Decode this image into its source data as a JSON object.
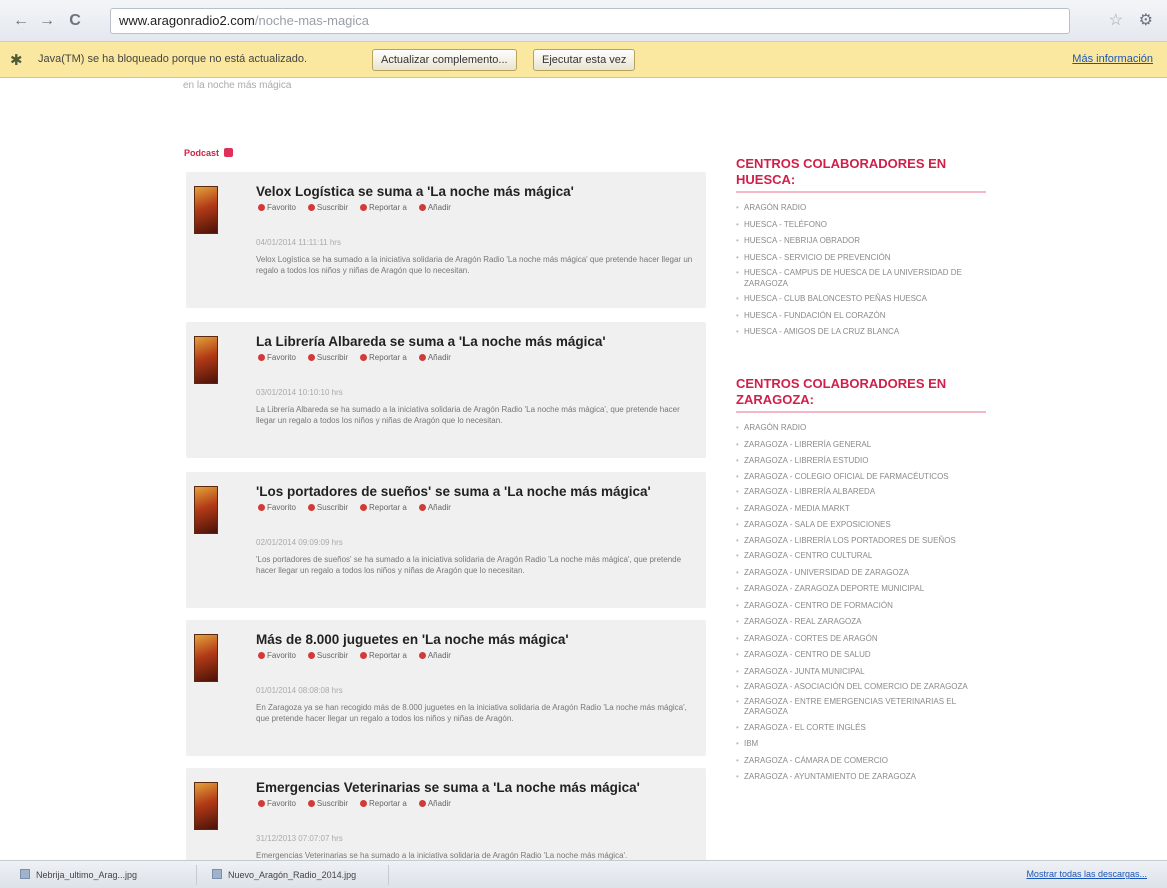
{
  "browser": {
    "url_host": "www.aragonradio2.com",
    "url_path": "/noche-mas-magica",
    "back_icon": "←",
    "forward_icon": "→",
    "reload_icon": "C",
    "star_icon": "☆",
    "wrench_icon": "⚙"
  },
  "infobar": {
    "message": "Java(TM) se ha bloqueado porque no está actualizado.",
    "update_button": "Actualizar complemento...",
    "run_button": "Ejecutar esta vez",
    "more_link": "Más información"
  },
  "faded_top": "en la noche más mágica",
  "feed": {
    "title": "Podcast",
    "actions": {
      "favorite": "Favorito",
      "subscribe": "Suscribir",
      "report": "Reportar a",
      "share": "Añadir"
    },
    "posts": [
      {
        "title": "Velox Logística se suma a 'La noche más mágica'",
        "date": "04/01/2014 11:11:11 hrs",
        "excerpt": "Velox Logística se ha sumado a la iniciativa solidaria de Aragón Radio 'La noche más mágica' que pretende hacer llegar un regalo a todos los niños y niñas de Aragón que lo necesitan."
      },
      {
        "title": "La Librería Albareda se suma a 'La noche más mágica'",
        "date": "03/01/2014 10:10:10 hrs",
        "excerpt": "La Librería Albareda se ha sumado a la iniciativa solidaria de Aragón Radio 'La noche más mágica', que pretende hacer llegar un regalo a todos los niños y niñas de Aragón que lo necesitan."
      },
      {
        "title": "'Los portadores de sueños' se suma a 'La noche más mágica'",
        "date": "02/01/2014 09:09:09 hrs",
        "excerpt": "'Los portadores de sueños' se ha sumado a la iniciativa solidaria de Aragón Radio 'La noche más mágica', que pretende hacer llegar un regalo a todos los niños y niñas de Aragón que lo necesitan."
      },
      {
        "title": "Más de 8.000 juguetes en 'La noche más mágica'",
        "date": "01/01/2014 08:08:08 hrs",
        "excerpt": "En Zaragoza ya se han recogido más de 8.000 juguetes en la iniciativa solidaria de Aragón Radio 'La noche más mágica', que pretende hacer llegar un regalo a todos los niños y niñas de Aragón."
      },
      {
        "title": "Emergencias Veterinarias se suma a 'La noche más mágica'",
        "date": "31/12/2013 07:07:07 hrs",
        "excerpt": "Emergencias Veterinarias se ha sumado a la iniciativa solidaria de Aragón Radio 'La noche más mágica'."
      }
    ]
  },
  "sidebar": {
    "huesca_heading": "CENTROS COLABORADORES EN HUESCA:",
    "huesca_items": [
      "ARAGÓN RADIO",
      "HUESCA - TELÉFONO",
      "HUESCA - NEBRIJA OBRADOR",
      "HUESCA - SERVICIO DE PREVENCIÓN",
      "HUESCA - CAMPUS DE HUESCA DE LA UNIVERSIDAD DE ZARAGOZA",
      "HUESCA - CLUB BALONCESTO PEÑAS HUESCA",
      "HUESCA - FUNDACIÓN EL CORAZÓN",
      "HUESCA - AMIGOS DE LA CRUZ BLANCA"
    ],
    "zaragoza_heading": "CENTROS COLABORADORES EN ZARAGOZA:",
    "zaragoza_items": [
      "ARAGÓN RADIO",
      "ZARAGOZA - LIBRERÍA GENERAL",
      "ZARAGOZA - LIBRERÍA ESTUDIO",
      "ZARAGOZA - COLEGIO OFICIAL DE FARMACÉUTICOS",
      "ZARAGOZA - LIBRERÍA ALBAREDA",
      "ZARAGOZA - MEDIA MARKT",
      "ZARAGOZA - SALA DE EXPOSICIONES",
      "ZARAGOZA - LIBRERÍA LOS PORTADORES DE SUEÑOS",
      "ZARAGOZA - CENTRO CULTURAL",
      "ZARAGOZA - UNIVERSIDAD DE ZARAGOZA",
      "ZARAGOZA - ZARAGOZA DEPORTE MUNICIPAL",
      "ZARAGOZA - CENTRO DE FORMACIÓN",
      "ZARAGOZA - REAL ZARAGOZA",
      "ZARAGOZA - CORTES DE ARAGÓN",
      "ZARAGOZA - CENTRO DE SALUD",
      "ZARAGOZA - JUNTA MUNICIPAL",
      "ZARAGOZA - ASOCIACIÓN DEL COMERCIO DE ZARAGOZA",
      "ZARAGOZA - ENTRE EMERGENCIAS VETERINARIAS EL ZARAGOZA",
      "ZARAGOZA - EL CORTE INGLÉS",
      "IBM",
      "ZARAGOZA - CÁMARA DE COMERCIO",
      "ZARAGOZA - AYUNTAMIENTO DE ZARAGOZA"
    ]
  },
  "downloads": {
    "items": [
      "Nebrija_ultimo_Arag...jpg",
      "Nuevo_Aragón_Radio_2014.jpg"
    ],
    "show_all": "Mostrar todas las descargas..."
  }
}
